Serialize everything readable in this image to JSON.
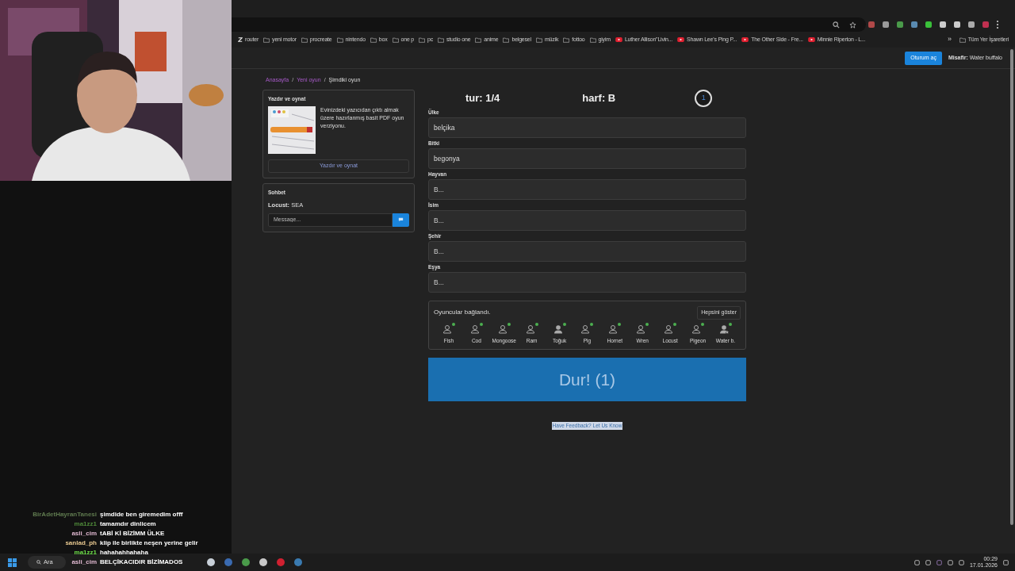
{
  "bookmarks": [
    {
      "label": "router",
      "kind": "site"
    },
    {
      "label": "yeni motor",
      "kind": "folder"
    },
    {
      "label": "procreate",
      "kind": "folder"
    },
    {
      "label": "nintendo",
      "kind": "folder"
    },
    {
      "label": "box",
      "kind": "folder"
    },
    {
      "label": "one p",
      "kind": "folder"
    },
    {
      "label": "pc",
      "kind": "folder"
    },
    {
      "label": "studio one",
      "kind": "folder"
    },
    {
      "label": "anime",
      "kind": "folder"
    },
    {
      "label": "belgesel",
      "kind": "folder"
    },
    {
      "label": "müzik",
      "kind": "folder"
    },
    {
      "label": "fottoo",
      "kind": "folder"
    },
    {
      "label": "giyim",
      "kind": "folder"
    },
    {
      "label": "Luther Allison\"Livin...",
      "kind": "video"
    },
    {
      "label": "Shawn Lee's Ping P...",
      "kind": "video"
    },
    {
      "label": "The Other Side - Fre...",
      "kind": "video"
    },
    {
      "label": "Minnie Riperton - L...",
      "kind": "video"
    }
  ],
  "bookmarks_more": "»",
  "other_bookmarks": "Tüm Yer İşaretleri",
  "header": {
    "login_button": "Oturum aç",
    "guest_label": "Misafir:",
    "guest_name": "Water buffalo"
  },
  "breadcrumbs": [
    {
      "label": "Anasayfa",
      "kind": "link"
    },
    {
      "label": "/",
      "kind": "separator"
    },
    {
      "label": "Yeni oyun",
      "kind": "link"
    },
    {
      "label": "/",
      "kind": "separator"
    },
    {
      "label": "Şimdiki oyun",
      "kind": "current"
    }
  ],
  "print_card": {
    "title": "Yazdır ve oynat",
    "description": "Evinizdeki yazıcıdan çıktı almak üzere hazırlanmış basit PDF oyun verziyonu.",
    "button": "Yazdır ve oynat"
  },
  "chat_card": {
    "title": "Sohbet",
    "messages": [
      {
        "author": "Locust:",
        "text": "SEA"
      }
    ],
    "input": {
      "placeholder": "Message..."
    }
  },
  "game": {
    "round": "tur: 1/4",
    "letter": "harf: B",
    "timer": "1"
  },
  "fields": [
    {
      "label": "Ülke",
      "value": "belçika"
    },
    {
      "label": "Bitki",
      "value": "begonya"
    },
    {
      "label": "Hayvan",
      "placeholder": "B..."
    },
    {
      "label": "İsim",
      "placeholder": "B..."
    },
    {
      "label": "Şehir",
      "placeholder": "B..."
    },
    {
      "label": "Eşya",
      "placeholder": "B..."
    }
  ],
  "players": {
    "status": "Oyuncular bağlandı.",
    "show_all": "Hepsini göster",
    "list": [
      {
        "name": "Fish",
        "online": true,
        "kind": "guest"
      },
      {
        "name": "Cod",
        "online": true,
        "kind": "guest"
      },
      {
        "name": "Mongoose",
        "online": true,
        "kind": "guest"
      },
      {
        "name": "Ram",
        "online": true,
        "kind": "guest"
      },
      {
        "name": "Toğuk",
        "online": true,
        "kind": "member"
      },
      {
        "name": "Pig",
        "online": true,
        "kind": "guest"
      },
      {
        "name": "Hornet",
        "online": true,
        "kind": "guest"
      },
      {
        "name": "Wren",
        "online": true,
        "kind": "guest"
      },
      {
        "name": "Locust",
        "online": true,
        "kind": "guest"
      },
      {
        "name": "Pigeon",
        "online": true,
        "kind": "guest"
      },
      {
        "name": "Water b.",
        "online": true,
        "kind": "self"
      }
    ]
  },
  "stop_button": "Dur! (1)",
  "feedback_link": "Have Feedback? Let Us Know",
  "stream_chat": [
    {
      "user": "BirAdetHayranTanesi",
      "color": "#5f7a4f",
      "text": "şimdide ben giremedim offf"
    },
    {
      "user": "ma1zz1",
      "color": "#4f8a3a",
      "text": "tamamdır dinlicem"
    },
    {
      "user": "asli_cim",
      "color": "#e0b8d0",
      "text": "tABİ Kİ BİZİMM ÜLKE"
    },
    {
      "user": "sanlad_ph",
      "color": "#e8c890",
      "text": "klip ile birlikte neşen yerine gelir"
    },
    {
      "user": "ma1zz1",
      "color": "#6ee04a",
      "text": "hahahahhahaha"
    },
    {
      "user": "asli_cim",
      "color": "#e0b8d0",
      "text": "BELÇİKACIDIR BİZİMADOS"
    }
  ],
  "taskbar": {
    "search": "Ara",
    "time": "00:29",
    "date": "17.01.2026"
  }
}
